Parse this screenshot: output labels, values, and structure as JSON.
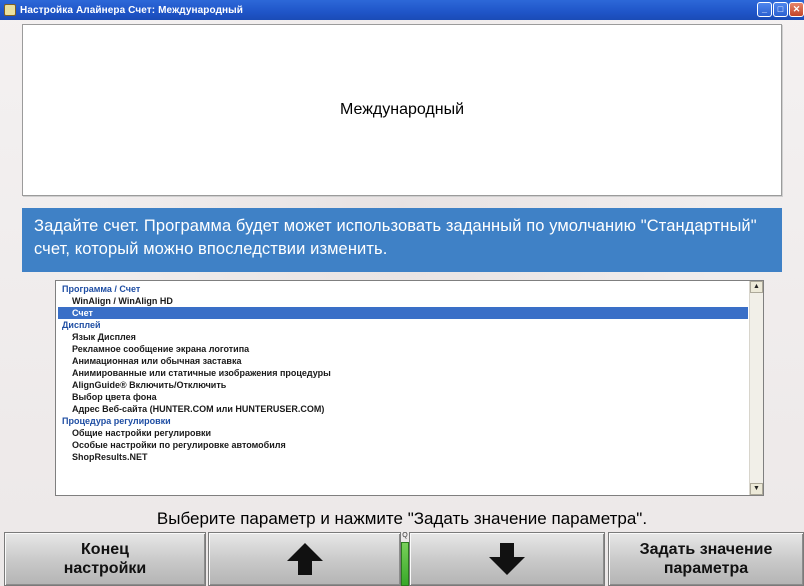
{
  "window": {
    "title": "Настройка Алайнера Счет: Международный",
    "buttons": {
      "minimize": "_",
      "maximize": "□",
      "close": "✕"
    }
  },
  "header": {
    "title": "Международный"
  },
  "instruction": "Задайте счет. Программа будет может использовать заданный по умолчанию \"Стандартный\" счет, который можно впоследствии изменить.",
  "list": {
    "selected_index": 2,
    "items": [
      {
        "label": "Программа / Счет",
        "kind": "section"
      },
      {
        "label": "WinAlign / WinAlign HD",
        "kind": "sub"
      },
      {
        "label": "Счет",
        "kind": "sub"
      },
      {
        "label": "Дисплей",
        "kind": "section"
      },
      {
        "label": "Язык Дисплея",
        "kind": "sub"
      },
      {
        "label": "Рекламное сообщение экрана логотипа",
        "kind": "sub"
      },
      {
        "label": "Анимационная или обычная заставка",
        "kind": "sub"
      },
      {
        "label": "Анимированные или статичные изображения процедуры",
        "kind": "sub"
      },
      {
        "label": "AlignGuide® Включить/Отключить",
        "kind": "sub"
      },
      {
        "label": "Выбор цвета фона",
        "kind": "sub"
      },
      {
        "label": "Адрес Веб-сайта (HUNTER.COM или HUNTERUSER.COM)",
        "kind": "sub"
      },
      {
        "label": "Процедура регулировки",
        "kind": "section"
      },
      {
        "label": "Общие настройки регулировки",
        "kind": "sub"
      },
      {
        "label": "Особые настройки по регулировке автомобиля",
        "kind": "sub"
      },
      {
        "label": "ShopResults.NET",
        "kind": "sub"
      }
    ],
    "scroll_up_icon": "scroll-up-icon",
    "scroll_down_icon": "scroll-down-icon"
  },
  "prompt": "Выберите параметр и нажмите \"Задать значение параметра\".",
  "fkeys": {
    "f1": "Конец\nнастройки",
    "f2_icon": "arrow-up-icon",
    "f3_icon": "arrow-down-icon",
    "f4": "Задать значение\nпараметра"
  },
  "indicator": {
    "icon": "magnifier-icon",
    "icon_glyph": "Q"
  },
  "colors": {
    "titlebar": "#2d68d8",
    "instruction_bg": "#3f81c6",
    "selected_bg": "#3a6fc7",
    "section_text": "#1f4ea3",
    "indicator_green": "#38a828"
  }
}
